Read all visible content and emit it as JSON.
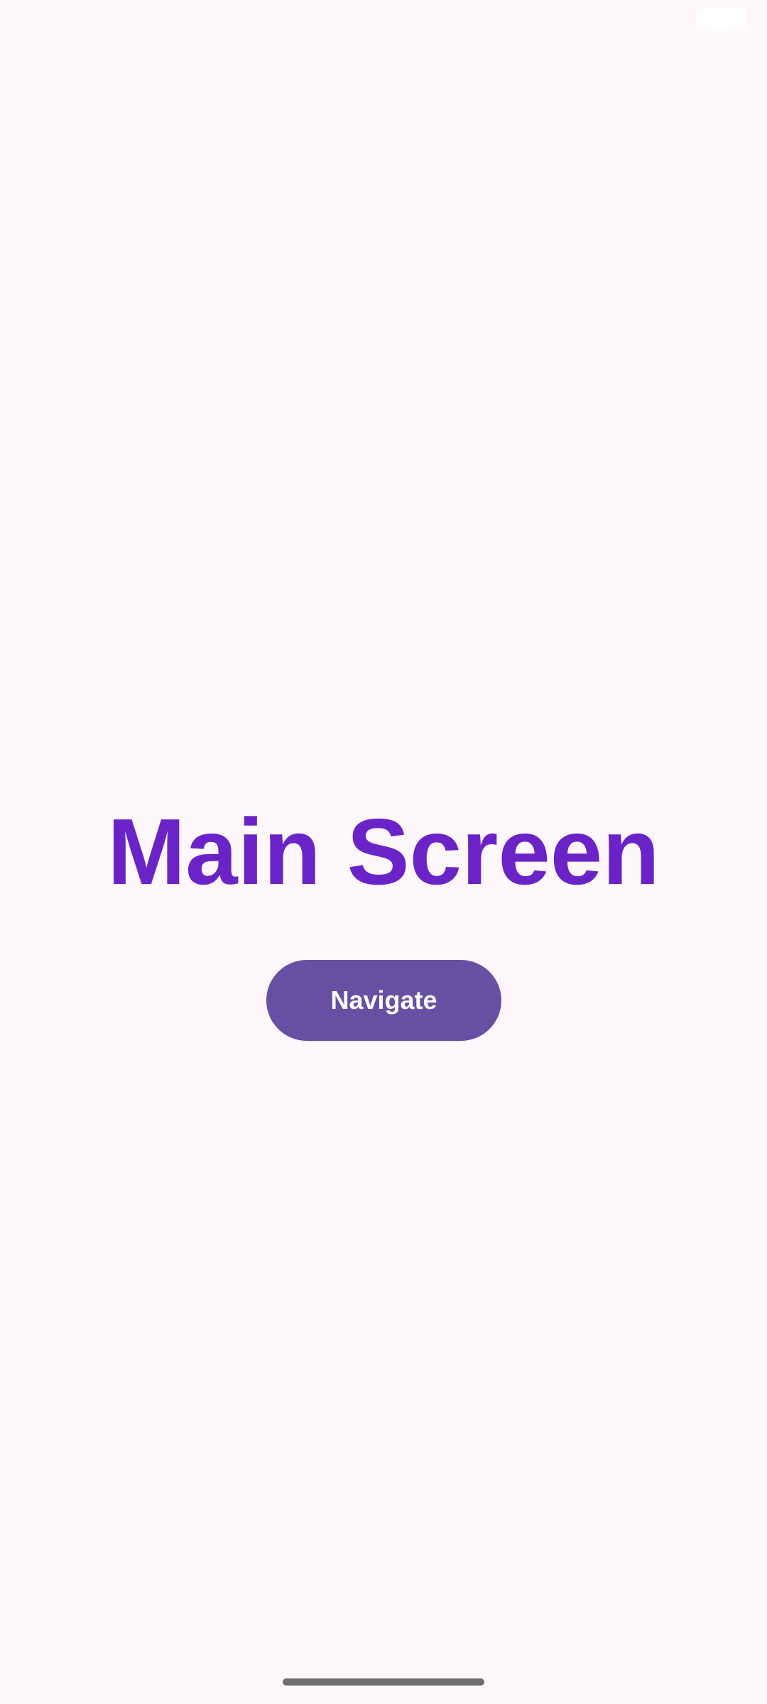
{
  "status_bar": {
    "time": "",
    "icons": [
      "wifi-icon",
      "signal-icon",
      "battery-icon"
    ]
  },
  "main": {
    "title": "Main Screen",
    "button_label": "Navigate"
  },
  "colors": {
    "background": "#fef7fb",
    "title": "#6a23c6",
    "button_bg": "#6750a4",
    "button_text": "#ffffff",
    "home_indicator": "#6e6e6e"
  }
}
